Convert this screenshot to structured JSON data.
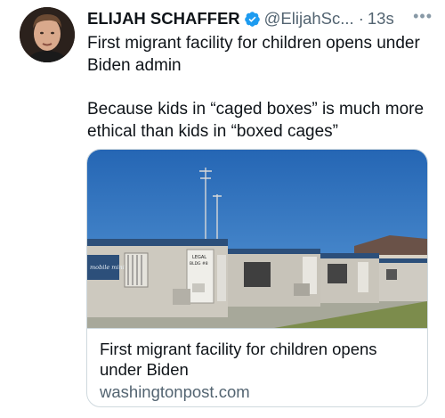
{
  "tweet": {
    "display_name": "ELIJAH SCHAFFER",
    "handle": "@ElijahSc...",
    "separator": "·",
    "timestamp": "13s",
    "more_label": "•••",
    "text_line1": "First migrant facility for children opens under Biden admin",
    "text_line2": "Because kids in “caged boxes” is much more ethical than kids in “boxed cages”"
  },
  "link_card": {
    "title": "First migrant facility for children opens under Biden",
    "domain": "washingtonpost.com",
    "image_signs": {
      "trailer1": "mobile mini",
      "trailer1_door_line1": "LEGAL",
      "trailer1_door_line2": "BLDG #8"
    }
  },
  "colors": {
    "verified_badge": "#1d9bf0",
    "secondary_text": "#536471",
    "card_border": "#cfd9de",
    "sky": "#2f78c4"
  },
  "icons": {
    "verified": "verified-badge-icon",
    "more": "more-dots-icon"
  }
}
